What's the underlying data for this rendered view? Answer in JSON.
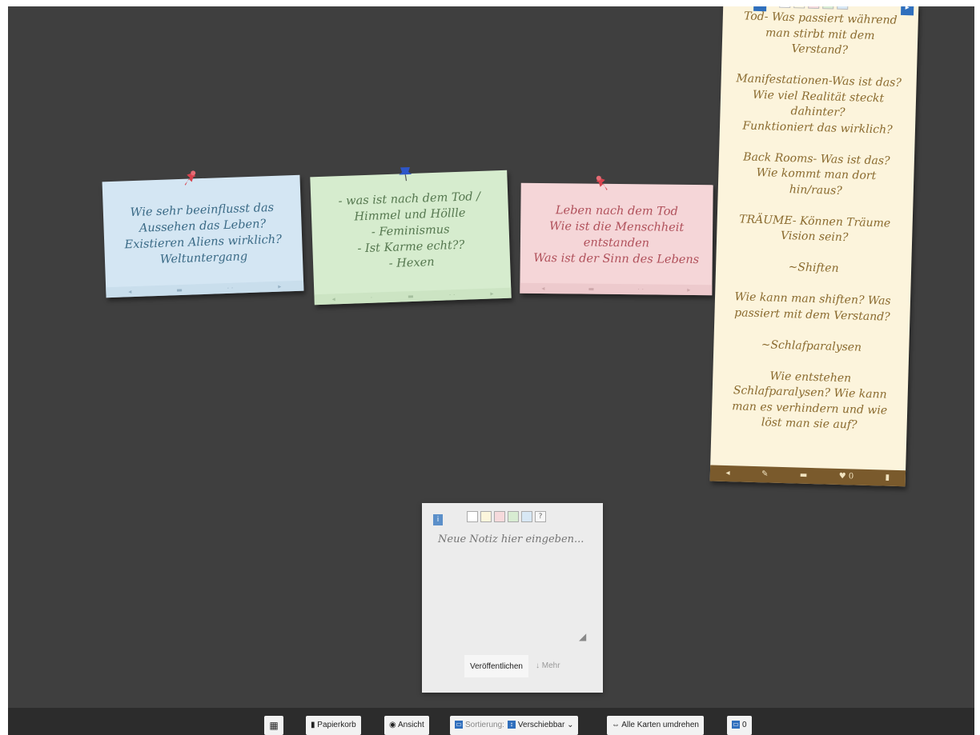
{
  "cards": [
    {
      "id": "card1",
      "color": "#d4e6f3",
      "pin": "red-pushpin",
      "text": "Wie sehr beeinflusst das\nAussehen das Leben?\nExistieren Aliens wirklich?\nWeltuntergang"
    },
    {
      "id": "card2",
      "color": "#d6ecce",
      "pin": "blue-pushpin",
      "text": "- was ist nach dem Tod /\nHimmel und Höllle\n- Feminismus\n- Ist Karme echt??\n- Hexen"
    },
    {
      "id": "card3",
      "color": "#f5d6d8",
      "pin": "red-pushpin",
      "text": "Leben nach dem Tod\nWie ist die Menschheit\nentstanden\nWas ist der Sinn des Lebens"
    },
    {
      "id": "card4",
      "color": "#fcf4dc",
      "pin": "none",
      "text": "Tod- Was passiert während\nman stirbt mit dem\nVerstand?\n\nManifestationen-Was ist das?\nWie viel Realität steckt\ndahinter?\nFunktioniert das wirklich?\n\nBack Rooms- Was ist das?\nWie kommt man dort\nhin/raus?\n\nTRÄUME- Können Träume\nVision sein?\n\n~Shiften\n\nWie kann man shiften? Was\npassiert mit dem Verstand?\n\n~Schlafparalysen\n\nWie entstehen\nSchlafparalysen? Wie kann\nman es verhindern und wie\nlöst man sie auf?"
    }
  ],
  "card4_footer_count": "0",
  "composer": {
    "placeholder": "Neue Notiz hier eingeben...",
    "publish_label": "Veröffentlichen",
    "more_label": "↓ Mehr",
    "swatch_colors": [
      "#ffffff",
      "#fdf6dc",
      "#f6dadc",
      "#d8ecd2",
      "#d8e8f5"
    ],
    "help_label": "?"
  },
  "toolbar": {
    "trash_label": "Papierkorb",
    "view_label": "Ansicht",
    "sort_label": "Sortierung:",
    "sort_value": "Verschiebbar",
    "flip_label": "Alle Karten umdrehen",
    "count": "0"
  }
}
